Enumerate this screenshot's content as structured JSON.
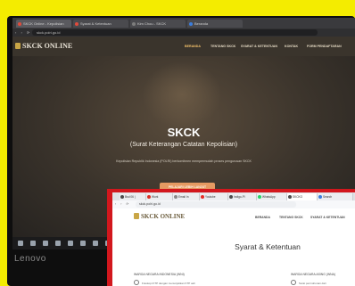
{
  "back_screen": {
    "tabs": [
      {
        "label": "SKCK Online - Kepolisian"
      },
      {
        "label": "Syarat & Ketentuan"
      },
      {
        "label": "Kim Chou - SKCK"
      },
      {
        "label": "Beranda"
      }
    ],
    "url": "skck.polri.go.id",
    "logo_text": "SKCK ONLINE",
    "nav": [
      "BERANDA",
      "TENTANG SKCK",
      "SYARAT & KETENTUAN",
      "KONTAK",
      "FORM PENDAFTARAN"
    ],
    "hero_title": "SKCK",
    "hero_subtitle": "(Surat Keterangan Catatan Kepolisian)",
    "hero_description": "Kepolisian Republik Indonesia (POLRI) berkomitmen mempermudah proses pengurusan SKCK",
    "cta_label": "PELAJARI LEBIH LANJUT",
    "brand": "Lenovo"
  },
  "front_screen": {
    "tabs": [
      {
        "label": "Bsd 06 |"
      },
      {
        "label": "Work"
      },
      {
        "label": "Email In"
      },
      {
        "label": "Youtube"
      },
      {
        "label": "Indigo-Pl"
      },
      {
        "label": "WhatsApp"
      },
      {
        "label": "SKCKO"
      },
      {
        "label": "Search"
      }
    ],
    "url": "skck.polri.go.id",
    "logo_text": "SKCK ONLINE",
    "nav": [
      "BERANDA",
      "TENTANG SKCK",
      "SYARAT & KETENTUAN"
    ],
    "page_title": "Syarat & Ketentuan",
    "col1_heading": "WARGA NEGARA INDONESIA (WNI)",
    "col1_item": "Fotokopi KTP dengan menunjukkan KTP asli",
    "col2_heading": "WARGA NEGARA ASING (WNA)",
    "col2_item": "Surat permohonan dari"
  },
  "colors": {
    "poster_yellow": "#f4ec00",
    "front_border_red": "#d2171d",
    "cta_orange": "#e59a62"
  }
}
